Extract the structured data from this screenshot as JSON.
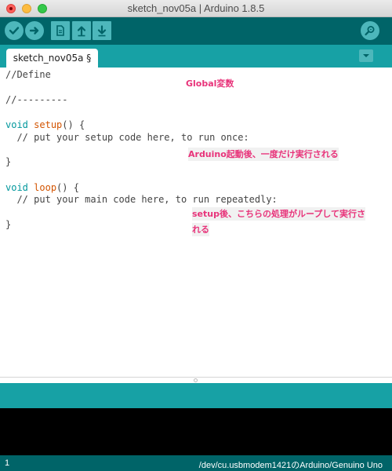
{
  "window": {
    "title": "sketch_nov05a | Arduino 1.8.5"
  },
  "toolbar": {
    "buttons": [
      {
        "name": "verify",
        "icon": "check-icon"
      },
      {
        "name": "upload",
        "icon": "arrow-right-icon"
      },
      {
        "name": "new",
        "icon": "document-icon"
      },
      {
        "name": "open",
        "icon": "arrow-up-icon"
      },
      {
        "name": "save",
        "icon": "arrow-down-icon"
      },
      {
        "name": "serial-monitor",
        "icon": "magnifier-icon"
      }
    ],
    "color": "#006468"
  },
  "tabs": [
    {
      "label": "sketch_nov05a §",
      "active": true
    }
  ],
  "editor": {
    "lines": {
      "define": "//Define",
      "sep": "//---------",
      "setup_kw": "void",
      "setup_fn": "setup",
      "setup_rest": "() {",
      "setup_comment": "  // put your setup code here, to run once:",
      "setup_close": "}",
      "loop_kw": "void",
      "loop_fn": "loop",
      "loop_rest": "() {",
      "loop_comment": "  // put your main code here, to run repeatedly:",
      "loop_close": "}"
    },
    "annotations": {
      "global": "Global変数",
      "setup": "Arduino起動後、一度だけ実行される",
      "loop_line1": "setup後、こちらの処理がループして実行さ",
      "loop_line2": "れる"
    },
    "annotation_color": "#e8337a"
  },
  "status": {
    "line_number": "1",
    "board": "/dev/cu.usbmodem1421のArduino/Genuino Uno"
  }
}
